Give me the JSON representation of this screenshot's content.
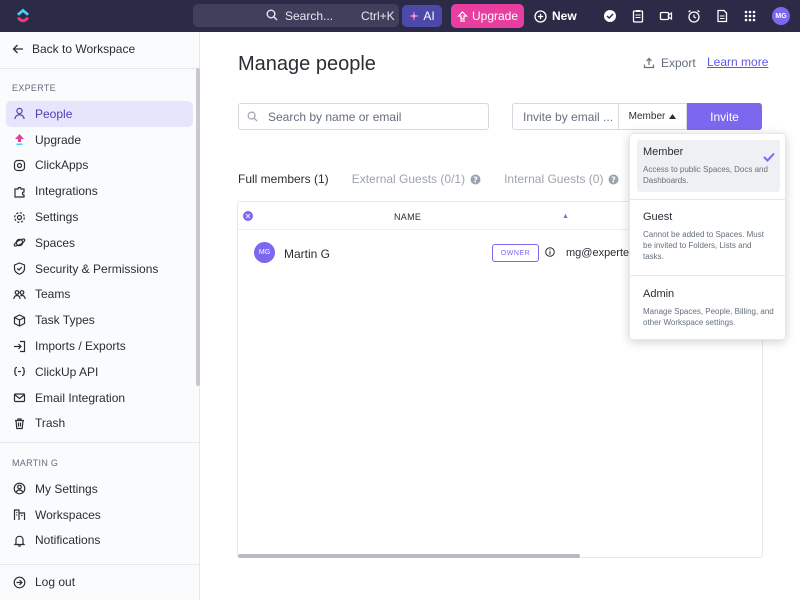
{
  "topbar": {
    "search_label": "Search...",
    "search_shortcut": "Ctrl+K",
    "ai_label": "AI",
    "upgrade_label": "Upgrade",
    "new_label": "New",
    "avatar_initials": "MG",
    "icons": [
      "check-circle-icon",
      "clipboard-icon",
      "video-icon",
      "alarm-clock-icon",
      "document-icon",
      "apps-grid-icon"
    ]
  },
  "sidebar": {
    "back_label": "Back to Workspace",
    "workspace_heading": "EXPERTE",
    "workspace_items": [
      {
        "label": "People",
        "icon": "person-icon",
        "active": true
      },
      {
        "label": "Upgrade",
        "icon": "upgrade-icon"
      },
      {
        "label": "ClickApps",
        "icon": "clickapps-icon"
      },
      {
        "label": "Integrations",
        "icon": "puzzle-icon"
      },
      {
        "label": "Settings",
        "icon": "gear-icon"
      },
      {
        "label": "Spaces",
        "icon": "spaces-icon"
      },
      {
        "label": "Security & Permissions",
        "icon": "shield-icon"
      },
      {
        "label": "Teams",
        "icon": "teams-icon"
      },
      {
        "label": "Task Types",
        "icon": "cube-icon"
      },
      {
        "label": "Imports / Exports",
        "icon": "import-icon"
      },
      {
        "label": "ClickUp API",
        "icon": "api-icon"
      },
      {
        "label": "Email Integration",
        "icon": "mail-icon"
      },
      {
        "label": "Trash",
        "icon": "trash-icon"
      }
    ],
    "user_heading": "MARTIN G",
    "user_items": [
      {
        "label": "My Settings",
        "icon": "user-circle-icon"
      },
      {
        "label": "Workspaces",
        "icon": "workspaces-icon"
      },
      {
        "label": "Notifications",
        "icon": "bell-icon"
      }
    ],
    "logout_label": "Log out"
  },
  "main": {
    "title": "Manage people",
    "export_label": "Export",
    "learn_more_label": "Learn more",
    "search_placeholder": "Search by name or email",
    "invite_placeholder": "Invite by email ...",
    "role_value": "Member",
    "invite_label": "Invite",
    "tabs": [
      {
        "label": "Full members (1)",
        "active": true
      },
      {
        "label": "External Guests (0/1)",
        "help": true
      },
      {
        "label": "Internal Guests (0)",
        "help": true
      }
    ],
    "table": {
      "name_header": "NAME",
      "rows": [
        {
          "initials": "MG",
          "name": "Martin G",
          "badge": "OWNER",
          "email": "mg@experte.de"
        }
      ]
    }
  },
  "role_dropdown": {
    "options": [
      {
        "title": "Member",
        "description": "Access to public Spaces, Docs and Dashboards.",
        "selected": true
      },
      {
        "title": "Guest",
        "description": "Cannot be added to Spaces. Must be invited to Folders, Lists and tasks."
      },
      {
        "title": "Admin",
        "description": "Manage Spaces, People, Billing, and other Workspace settings."
      }
    ]
  },
  "colors": {
    "topbar": "#2b2b48",
    "accent": "#7b68ee",
    "upgrade": "#e83ea0",
    "active_nav": "#e7e5fb"
  }
}
